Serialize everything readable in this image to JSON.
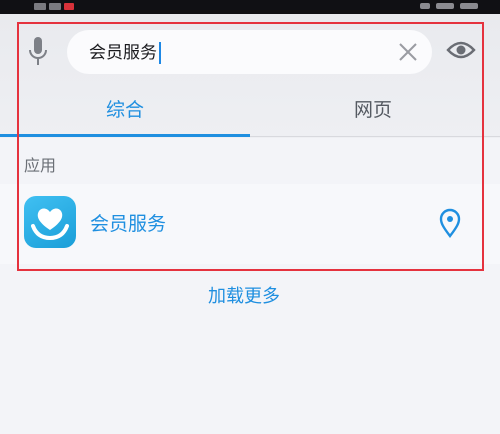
{
  "search": {
    "query": "会员服务"
  },
  "tabs": [
    {
      "label": "综合",
      "active": true
    },
    {
      "label": "网页",
      "active": false
    }
  ],
  "results": {
    "section_label": "应用",
    "apps": [
      {
        "name": "会员服务",
        "icon": "heart-hand-icon",
        "action_icon": "location-pin-icon"
      }
    ],
    "load_more": "加载更多"
  },
  "icons": {
    "voice": "microphone-icon",
    "clear": "close-icon",
    "view": "eye-icon"
  },
  "colors": {
    "accent": "#1f8fe0",
    "annotation_frame": "#e5323e"
  }
}
